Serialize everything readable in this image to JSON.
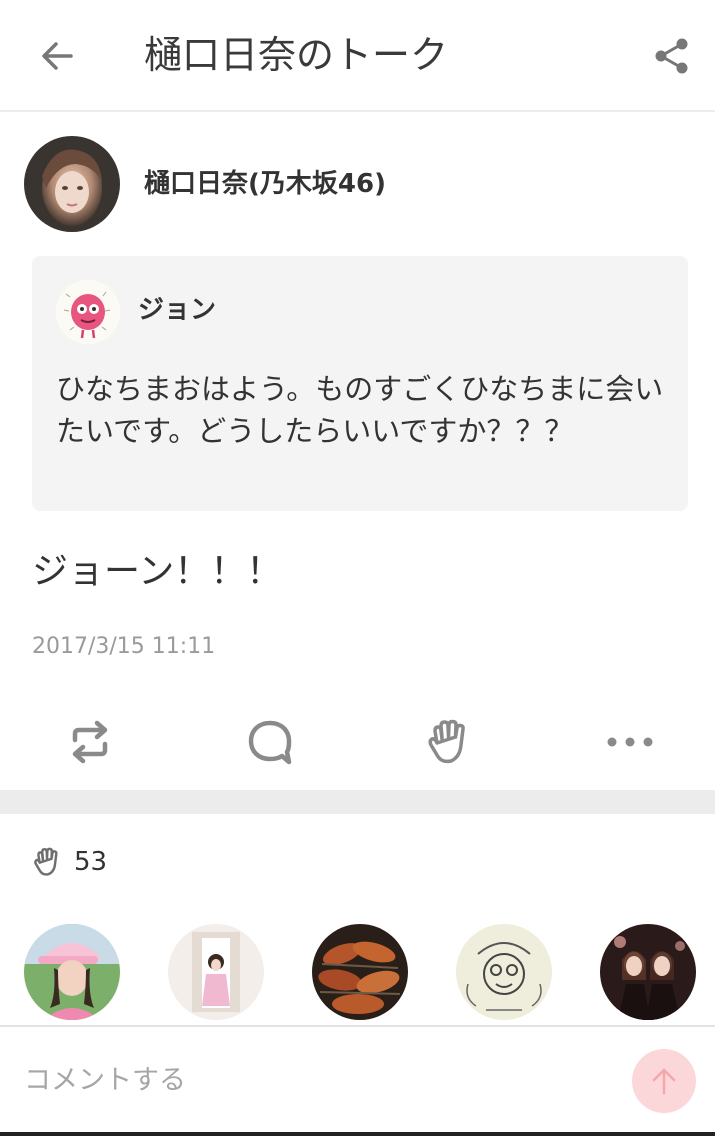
{
  "header": {
    "title": "樋口日奈のトーク",
    "back_icon": "arrow-left-icon",
    "share_icon": "share-icon"
  },
  "post": {
    "author_name": "樋口日奈(乃木坂46)",
    "quoted": {
      "name": "ジョン",
      "text": "ひなちまおはよう。ものすごくひなちまに会いたいです。どうしたらいいですか？？？"
    },
    "reply_text": "ジョーン！！！",
    "timestamp": "2017/3/15 11:11"
  },
  "actions": {
    "icons": [
      "retweet-icon",
      "comment-bubble-icon",
      "applause-hand-icon",
      "more-dots-icon"
    ]
  },
  "likes": {
    "count": "53",
    "icon": "applause-hand-icon"
  },
  "comment_bar": {
    "placeholder": "コメントする",
    "send_icon": "arrow-up-icon"
  },
  "colors": {
    "accent_send": "#fcd7d9",
    "icon_gray": "#8a8a8a",
    "separator": "#ececec",
    "timestamp": "#9a9a9a"
  }
}
